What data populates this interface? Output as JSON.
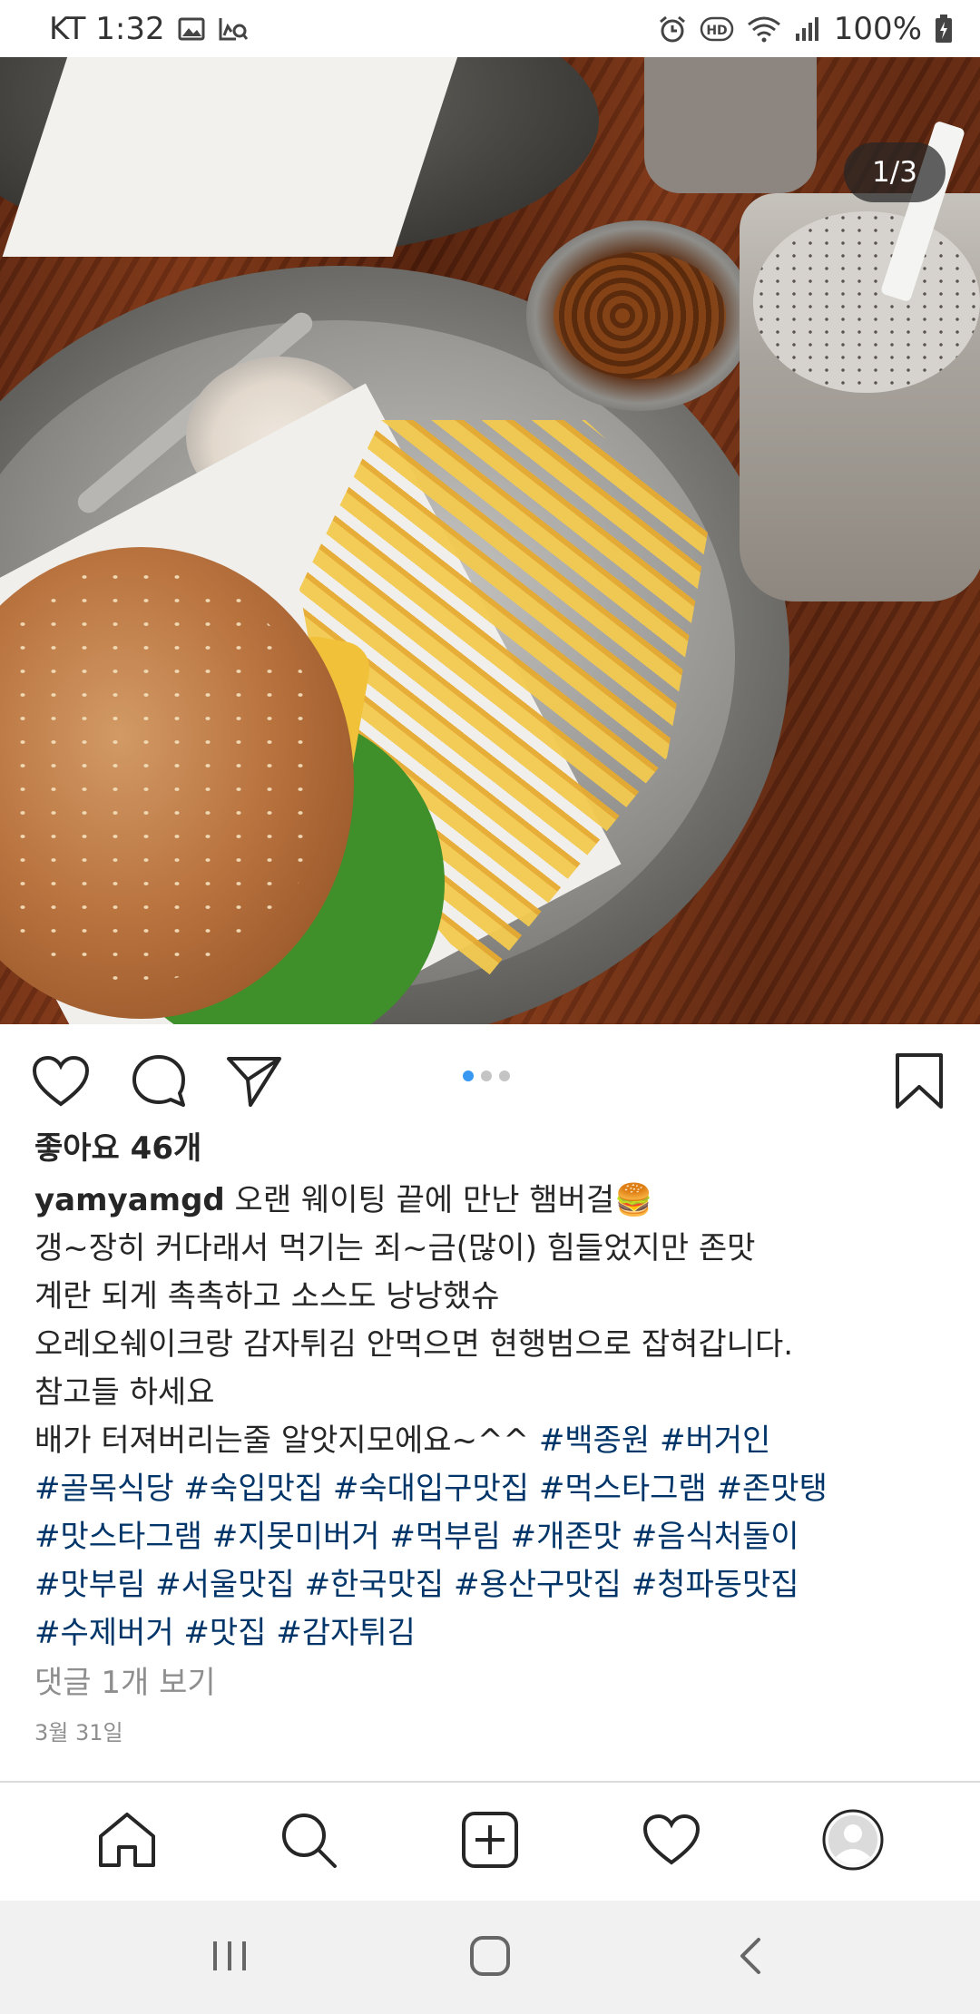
{
  "status_bar": {
    "carrier_time": "KT 1:32",
    "battery": "100%",
    "icons": [
      "gallery-icon",
      "screenshot-search-icon",
      "alarm-icon",
      "hd-icon",
      "wifi-icon",
      "signal-icon",
      "battery-charging-icon"
    ]
  },
  "photo": {
    "counter": "1/3",
    "carousel_count": 3,
    "carousel_index": 1
  },
  "actions": {
    "icons": [
      "heart-icon",
      "comment-icon",
      "share-icon",
      "bookmark-icon"
    ]
  },
  "post": {
    "likes": "좋아요 46개",
    "username": "yamyamgd",
    "caption_first": " 오랜 웨이팅 끝에 만난 햄버걸🍔",
    "caption_lines": [
      "갱~장히 커다래서 먹기는 죄~금(많이) 힘들었지만 존맛",
      "계란 되게 촉촉하고 소스도 낭낭했슈",
      "오레오쉐이크랑 감자튀김 안먹으면 현행범으로 잡혀갑니다.",
      "참고들 하세요"
    ],
    "last_line_text": "배가 터져버리는줄 알앗지모에요~^^ ",
    "hashtags": [
      "#백종원",
      "#버거인",
      "#골목식당",
      "#숙입맛집",
      "#숙대입구맛집",
      "#먹스타그램",
      "#존맛탱",
      "#맛스타그램",
      "#지못미버거",
      "#먹부림",
      "#개존맛",
      "#음식처돌이",
      "#맛부림",
      "#서울맛집",
      "#한국맛집",
      "#용산구맛집",
      "#청파동맛집",
      "#수제버거",
      "#맛집",
      "#감자튀김"
    ],
    "comments_link": "댓글 1개 보기",
    "date": "3월 31일"
  },
  "bottom_nav": {
    "items": [
      "home-icon",
      "search-icon",
      "add-post-icon",
      "activity-heart-icon",
      "profile-avatar-icon"
    ]
  },
  "system_nav": {
    "items": [
      "recent-apps-icon",
      "home-button-icon",
      "back-icon"
    ]
  }
}
